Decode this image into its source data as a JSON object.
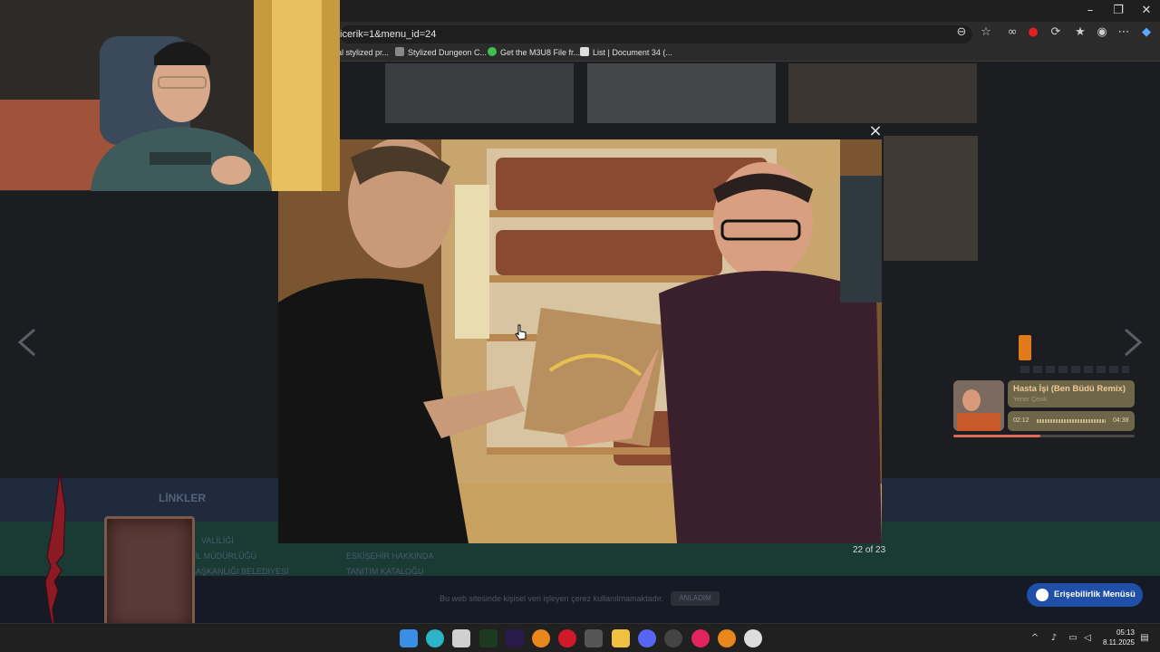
{
  "browser": {
    "url": "icerik=1&menu_id=24",
    "bookmarks": [
      {
        "label": "al stylized pr..."
      },
      {
        "label": "Stylized Dungeon C..."
      },
      {
        "label": "Get the M3U8 File fr..."
      },
      {
        "label": "List | Document 34 (..."
      }
    ],
    "icons": [
      "reader-icon",
      "star-icon",
      "extensions-icon",
      "favorites-icon",
      "profile-icon",
      "more-icon",
      "copilot-icon"
    ]
  },
  "page": {
    "footer": {
      "heading": "LİNKLER",
      "links_left": [
        "VALİLİĞİ",
        "İL MÜDÜRLÜĞÜ",
        "BAŞKANLIĞI BELEDİYESİ"
      ],
      "links_right": [
        "ESKİŞEHİR HAKKINDA",
        "TANITIM KATALOĞU"
      ]
    },
    "cookie": {
      "text": "Bu web sitesinde kişisel veri işleyen çerez kullanılmamaktadır.",
      "button": "ANLADIM"
    },
    "accessibility_button": "Erişebilirlik Menüsü"
  },
  "lightbox": {
    "close": "×",
    "counter": "22 of 23"
  },
  "music_player": {
    "title": "Hasta İşi (Ben Büdü Remix)",
    "artist": "Yener Çevik",
    "elapsed": "02:12",
    "duration": "04:38",
    "progress": 0.48
  },
  "taskbar": {
    "time": "05:13",
    "date": "8.11.2025"
  },
  "colors": {
    "accent_blue": "#1f4fa8",
    "footer_teal": "#1a3a34"
  }
}
